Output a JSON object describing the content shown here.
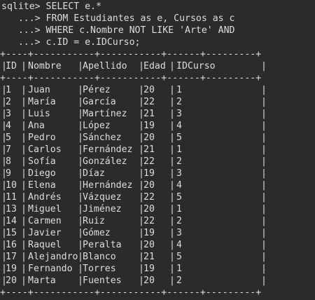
{
  "terminal": {
    "query_lines": [
      "sqlite> SELECT e.*",
      "   ...> FROM Estudiantes as e, Cursos as c",
      "   ...> WHERE c.Nombre NOT LIKE 'Arte' AND",
      "   ...> c.ID = e.IDCurso;"
    ],
    "border_top": "+----+-----------+-----------+------+---------+",
    "border_mid": "+----+-----------+-----------+------+---------+",
    "border_bottom": "+----+-----------+-----------+------+---------+",
    "headers": [
      "ID",
      "Nombre",
      "Apellido",
      "Edad",
      "IDCurso"
    ],
    "rows": [
      [
        "1",
        "Juan",
        "Pérez",
        "20",
        "1"
      ],
      [
        "2",
        "María",
        "García",
        "22",
        "2"
      ],
      [
        "3",
        "Luis",
        "Martínez",
        "21",
        "3"
      ],
      [
        "4",
        "Ana",
        "López",
        "19",
        "4"
      ],
      [
        "5",
        "Pedro",
        "Sánchez",
        "20",
        "5"
      ],
      [
        "7",
        "Carlos",
        "Fernández",
        "21",
        "1"
      ],
      [
        "8",
        "Sofía",
        "González",
        "22",
        "2"
      ],
      [
        "9",
        "Diego",
        "Díaz",
        "19",
        "3"
      ],
      [
        "10",
        "Elena",
        "Hernández",
        "20",
        "4"
      ],
      [
        "11",
        "Andrés",
        "Vázquez",
        "22",
        "5"
      ],
      [
        "13",
        "Miguel",
        "Jiménez",
        "20",
        "1"
      ],
      [
        "14",
        "Carmen",
        "Ruiz",
        "22",
        "2"
      ],
      [
        "15",
        "Javier",
        "Gómez",
        "19",
        "3"
      ],
      [
        "16",
        "Raquel",
        "Peralta",
        "20",
        "4"
      ],
      [
        "17",
        "Alejandro",
        "Blanco",
        "21",
        "5"
      ],
      [
        "19",
        "Fernando",
        "Torres",
        "19",
        "1"
      ],
      [
        "20",
        "Marta",
        "Fuentes",
        "20",
        "2"
      ]
    ],
    "prompt_partial": "sqlite>"
  }
}
